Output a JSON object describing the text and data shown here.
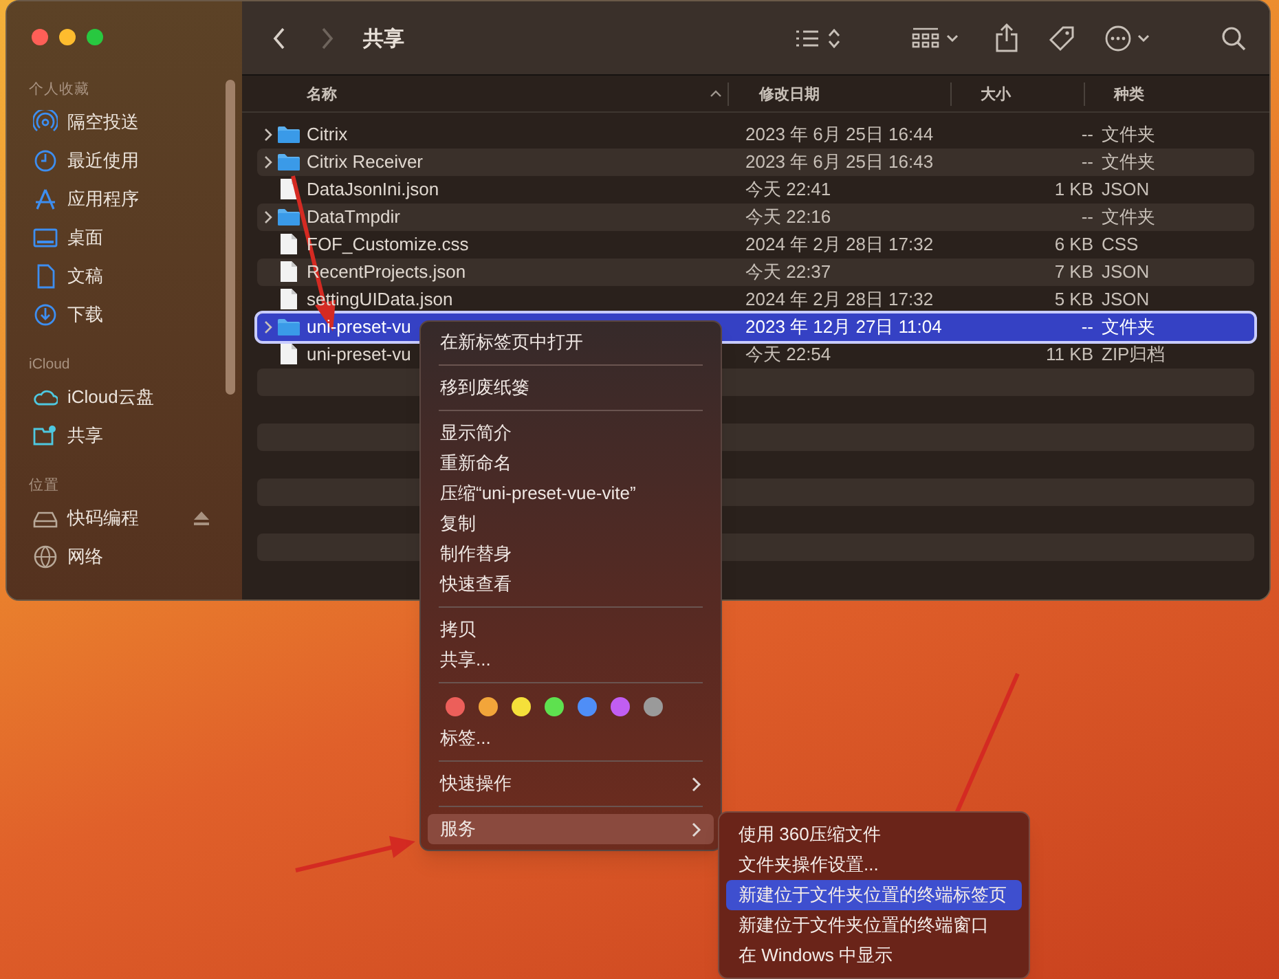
{
  "window": {
    "title": "共享"
  },
  "sidebar": {
    "sections": [
      {
        "heading": "个人收藏",
        "items": [
          {
            "label": "隔空投送",
            "ejectable": false
          },
          {
            "label": "最近使用",
            "ejectable": false
          },
          {
            "label": "应用程序",
            "ejectable": false
          },
          {
            "label": "桌面",
            "ejectable": false
          },
          {
            "label": "文稿",
            "ejectable": false
          },
          {
            "label": "下载",
            "ejectable": false
          }
        ]
      },
      {
        "heading": "iCloud",
        "items": [
          {
            "label": "iCloud云盘",
            "ejectable": false
          },
          {
            "label": "共享",
            "ejectable": false
          }
        ]
      },
      {
        "heading": "位置",
        "items": [
          {
            "label": "快码编程",
            "ejectable": true
          },
          {
            "label": "网络",
            "ejectable": false
          }
        ]
      }
    ]
  },
  "table": {
    "columns": [
      "名称",
      "修改日期",
      "大小",
      "种类"
    ],
    "rows": [
      {
        "kind": "folder",
        "name": "Citrix",
        "modified": "2023 年 6月 25日 16:44",
        "size": "--",
        "type": "文件夹",
        "selected": false
      },
      {
        "kind": "folder",
        "name": "Citrix Receiver",
        "modified": "2023 年 6月 25日 16:43",
        "size": "--",
        "type": "文件夹",
        "selected": false
      },
      {
        "kind": "file",
        "name": "DataJsonIni.json",
        "modified": "今天 22:41",
        "size": "1 KB",
        "type": "JSON",
        "selected": false
      },
      {
        "kind": "folder",
        "name": "DataTmpdir",
        "modified": "今天 22:16",
        "size": "--",
        "type": "文件夹",
        "selected": false
      },
      {
        "kind": "file",
        "name": "FOF_Customize.css",
        "modified": "2024 年 2月 28日 17:32",
        "size": "6 KB",
        "type": "CSS",
        "selected": false
      },
      {
        "kind": "file",
        "name": "RecentProjects.json",
        "modified": "今天 22:37",
        "size": "7 KB",
        "type": "JSON",
        "selected": false
      },
      {
        "kind": "file",
        "name": "settingUIData.json",
        "modified": "2024 年 2月 28日 17:32",
        "size": "5 KB",
        "type": "JSON",
        "selected": false
      },
      {
        "kind": "folder",
        "name": "uni-preset-vu",
        "modified": "2023 年 12月 27日 11:04",
        "size": "--",
        "type": "文件夹",
        "selected": true
      },
      {
        "kind": "file",
        "name": "uni-preset-vu",
        "modified": "今天 22:54",
        "size": "11 KB",
        "type": "ZIP归档",
        "selected": false
      }
    ]
  },
  "context_menu": {
    "items": [
      {
        "kind": "item",
        "label": "在新标签页中打开",
        "selected": false
      },
      {
        "kind": "separator"
      },
      {
        "kind": "item",
        "label": "移到废纸篓",
        "selected": false
      },
      {
        "kind": "separator"
      },
      {
        "kind": "item",
        "label": "显示简介",
        "selected": false
      },
      {
        "kind": "item",
        "label": "重新命名",
        "selected": false
      },
      {
        "kind": "item",
        "label": "压缩“uni-preset-vue-vite”",
        "selected": false
      },
      {
        "kind": "item",
        "label": "复制",
        "selected": false
      },
      {
        "kind": "item",
        "label": "制作替身",
        "selected": false
      },
      {
        "kind": "item",
        "label": "快速查看",
        "selected": false
      },
      {
        "kind": "separator"
      },
      {
        "kind": "item",
        "label": "拷贝",
        "selected": false
      },
      {
        "kind": "item",
        "label": "共享...",
        "selected": false
      },
      {
        "kind": "separator"
      },
      {
        "kind": "tags",
        "tags": [
          {
            "color": "#ec5f5a"
          },
          {
            "color": "#f2a53a"
          },
          {
            "color": "#f5e03a"
          },
          {
            "color": "#5ee14f"
          },
          {
            "color": "#4f8ef7"
          },
          {
            "color": "#c15ef2"
          },
          {
            "color": "#9a9a9a"
          }
        ]
      },
      {
        "kind": "item",
        "label": "标签...",
        "selected": false
      },
      {
        "kind": "separator"
      },
      {
        "kind": "submenu",
        "label": "快速操作",
        "selected": false
      },
      {
        "kind": "separator"
      },
      {
        "kind": "submenu",
        "label": "服务",
        "selected": true
      }
    ]
  },
  "services_menu": {
    "items": [
      {
        "label": "使用 360压缩文件",
        "selected": false
      },
      {
        "label": "文件夹操作设置...",
        "selected": false
      },
      {
        "label": "新建位于文件夹位置的终端标签页",
        "selected": true
      },
      {
        "label": "新建位于文件夹位置的终端窗口",
        "selected": false
      },
      {
        "label": "在 Windows 中显示",
        "selected": false
      }
    ]
  }
}
